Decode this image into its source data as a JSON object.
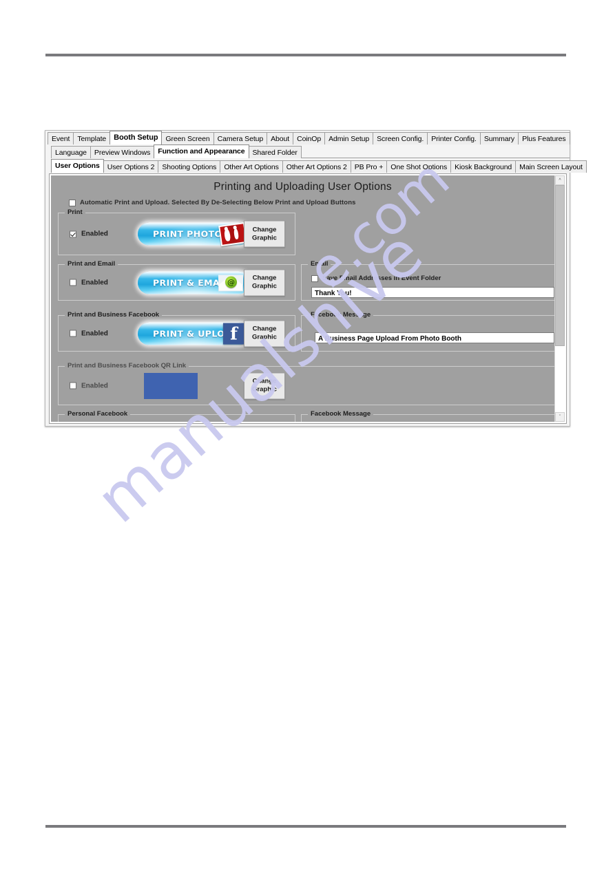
{
  "window": {
    "tab_rows": [
      {
        "name": "main-tabs",
        "tabs": [
          {
            "label": "Event",
            "selected": false
          },
          {
            "label": "Template",
            "selected": false
          },
          {
            "label": "Booth Setup",
            "selected": true
          },
          {
            "label": "Green Screen",
            "selected": false
          },
          {
            "label": "Camera Setup",
            "selected": false
          },
          {
            "label": "About",
            "selected": false
          },
          {
            "label": "CoinOp",
            "selected": false
          },
          {
            "label": "Admin Setup",
            "selected": false
          },
          {
            "label": "Screen Config.",
            "selected": false
          },
          {
            "label": "Printer Config.",
            "selected": false
          },
          {
            "label": "Summary",
            "selected": false
          },
          {
            "label": "Plus Features",
            "selected": false
          }
        ]
      },
      {
        "name": "booth-setup-tabs",
        "tabs": [
          {
            "label": "Language",
            "selected": false
          },
          {
            "label": "Preview Windows",
            "selected": false
          },
          {
            "label": "Function and Appearance",
            "selected": true
          },
          {
            "label": "Shared Folder",
            "selected": false
          }
        ]
      },
      {
        "name": "function-appearance-tabs",
        "tabs": [
          {
            "label": "User Options",
            "selected": true
          },
          {
            "label": "User Options 2",
            "selected": false
          },
          {
            "label": "Shooting Options",
            "selected": false
          },
          {
            "label": "Other Art Options",
            "selected": false
          },
          {
            "label": "Other Art Options 2",
            "selected": false
          },
          {
            "label": "PB Pro +",
            "selected": false
          },
          {
            "label": "One Shot Options",
            "selected": false
          },
          {
            "label": "Kiosk Background",
            "selected": false
          },
          {
            "label": "Main Screen Layout",
            "selected": false
          }
        ]
      }
    ]
  },
  "pane": {
    "title": "Printing and Uploading User Options",
    "automatic": {
      "label": "Automatic Print and Upload. Selected By De-Selecting Below Print and Upload Buttons",
      "checked": false
    },
    "enabled_label": "Enabled",
    "change_graphic": {
      "line1": "Change",
      "line2": "Graphic"
    },
    "groups": {
      "print": {
        "label": "Print",
        "enabled": true,
        "button_text": "PRINT PHOTO",
        "icon": "photo-strip-icon"
      },
      "print_and_email": {
        "label": "Print and Email",
        "enabled": false,
        "button_text": "PRINT & EMAIL",
        "icon": "envelope-at-icon"
      },
      "print_and_business_facebook": {
        "label": "Print and Business Facebook",
        "enabled": false,
        "button_text": "PRINT & UPLOAD",
        "icon": "facebook-f-icon"
      },
      "print_and_business_facebook_qr": {
        "label": "Print and Business Facebook QR Link",
        "enabled": false,
        "graphic_color": "#3f63b0"
      },
      "personal_facebook": {
        "label": "Personal Facebook"
      }
    },
    "email_panel": {
      "label": "Email",
      "save_checkbox_label": "Save Email Addresses in Event Folder",
      "save_checked": false,
      "message_value": "Thank You!"
    },
    "facebook_message_panel": {
      "label": "Facebook Message",
      "message_value": "A Business Page Upload From Photo Booth"
    },
    "facebook_message_panel_2": {
      "label": "Facebook Message"
    },
    "scrollbar": {
      "up_arrow": "^",
      "down_arrow": "ˇ"
    }
  },
  "watermark": {
    "line1": "manualshive",
    "line2": "e.com"
  }
}
